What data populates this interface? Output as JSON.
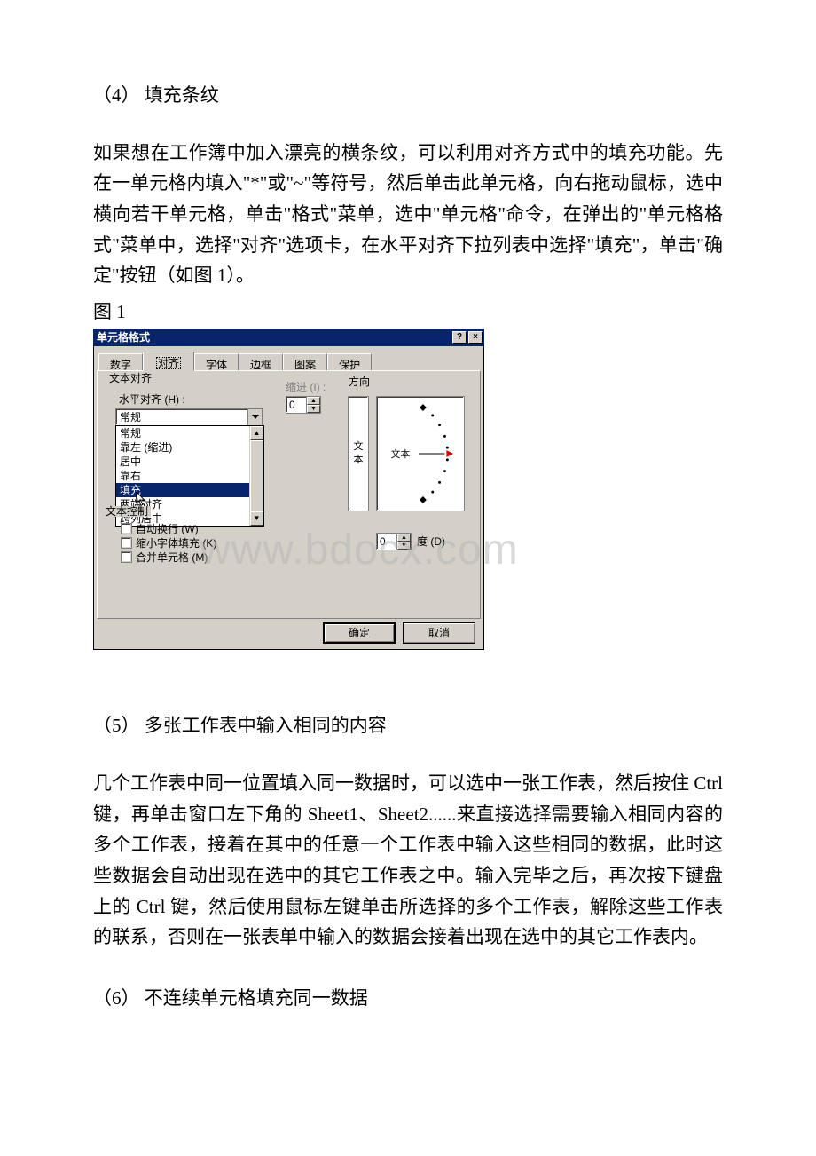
{
  "section4": {
    "title": "（4） 填充条纹",
    "body": "如果想在工作簿中加入漂亮的横条纹，可以利用对齐方式中的填充功能。先在一单元格内填入\"*\"或\"~\"等符号，然后单击此单元格，向右拖动鼠标，选中横向若干单元格，单击\"格式\"菜单，选中\"单元格\"命令，在弹出的\"单元格格式\"菜单中，选择\"对齐\"选项卡，在水平对齐下拉列表中选择\"填充\"，单击\"确定\"按钮（如图 1）。",
    "fig_label": "图 1"
  },
  "dialog": {
    "title": "单元格格式",
    "help_btn": "?",
    "close_btn": "×",
    "tabs": {
      "number": "数字",
      "align": "对齐",
      "font": "字体",
      "border": "边框",
      "pattern": "图案",
      "protect": "保护"
    },
    "text_align_group": "文本对齐",
    "h_align_label": "水平对齐 (H) :",
    "h_align_value": "常规",
    "h_align_options": [
      "常规",
      "靠左 (缩进)",
      "居中",
      "靠右",
      "填充",
      "两端对齐",
      "跨列居中"
    ],
    "indent_label": "缩进 (I) :",
    "indent_value": "0",
    "text_control_label": "文本控制",
    "chk_wrap": "自动换行 (W)",
    "chk_shrink": "缩小字体填充 (K)",
    "chk_merge": "合并单元格 (M)",
    "direction_label": "方向",
    "dir_v_text": "文本",
    "dir_h_text": "文本",
    "degree_value": "0",
    "degree_label": "度 (D)",
    "ok": "确定",
    "cancel": "取消"
  },
  "watermark": "www.bdocx.com",
  "section5": {
    "title": "（5） 多张工作表中输入相同的内容",
    "body": "几个工作表中同一位置填入同一数据时，可以选中一张工作表，然后按住 Ctrl 键，再单击窗口左下角的 Sheet1、Sheet2......来直接选择需要输入相同内容的多个工作表，接着在其中的任意一个工作表中输入这些相同的数据，此时这些数据会自动出现在选中的其它工作表之中。输入完毕之后，再次按下键盘上的 Ctrl 键，然后使用鼠标左键单击所选择的多个工作表，解除这些工作表的联系，否则在一张表单中输入的数据会接着出现在选中的其它工作表内。"
  },
  "section6": {
    "title": "（6） 不连续单元格填充同一数据"
  },
  "chart_data": null
}
